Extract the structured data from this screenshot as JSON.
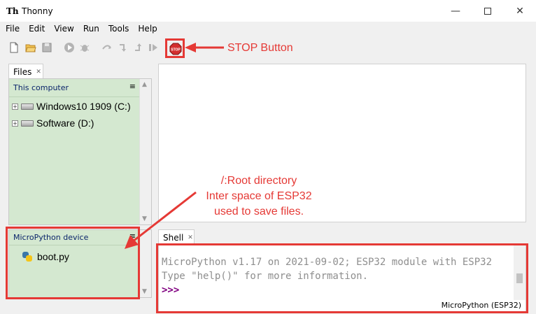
{
  "window": {
    "title": "Thonny",
    "app_icon_text": "Th"
  },
  "menu": [
    "File",
    "Edit",
    "View",
    "Run",
    "Tools",
    "Help"
  ],
  "toolbar": {
    "icons": [
      "new-file-icon",
      "open-folder-icon",
      "save-icon",
      "run-icon",
      "debug-icon",
      "step-over-icon",
      "step-into-icon",
      "step-out-icon",
      "resume-icon",
      "stop-icon"
    ],
    "stop_label": "STOP"
  },
  "files": {
    "tab_label": "Files",
    "this_computer_title": "This computer",
    "drives": [
      "Windows10 1909 (C:)",
      "Software (D:)"
    ],
    "device_title": "MicroPython device",
    "device_files": [
      "boot.py"
    ]
  },
  "shell": {
    "tab_label": "Shell",
    "lines": [
      "MicroPython v1.17 on 2021-09-02; ESP32 module with ESP32",
      "Type \"help()\" for more information."
    ],
    "prompt": ">>>",
    "interpreter": "MicroPython (ESP32)"
  },
  "annotations": {
    "stop_button": "STOP Button",
    "root_line1": "/:Root directory",
    "root_line2": "Inter space of ESP32",
    "root_line3": "used to save files."
  },
  "colors": {
    "annotation_red": "#e53935",
    "panel_green": "#d4e8d0",
    "prompt_purple": "#800080"
  }
}
